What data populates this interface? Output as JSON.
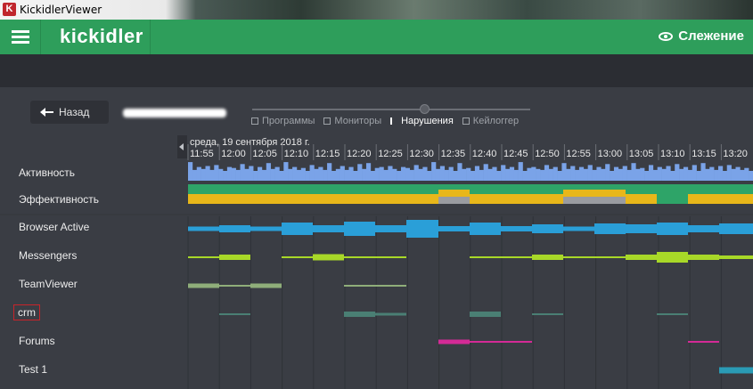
{
  "window": {
    "title": "KickidlerViewer",
    "icon_letter": "K"
  },
  "header": {
    "logo": "kickidler",
    "mode_label": "Слежение"
  },
  "back_button": {
    "label": "Назад"
  },
  "view_tabs": [
    {
      "label": "Программы",
      "icon": "folder-icon",
      "active": false
    },
    {
      "label": "Мониторы",
      "icon": "monitor-icon",
      "active": false
    },
    {
      "label": "Нарушения",
      "icon": "flag-icon",
      "active": true
    },
    {
      "label": "Кейлоггер",
      "icon": "keyboard-icon",
      "active": false
    }
  ],
  "timeline": {
    "date": "среда, 19 сентября 2018 г.",
    "times": [
      "11:55",
      "12:00",
      "12:05",
      "12:10",
      "12:15",
      "12:20",
      "12:25",
      "12:30",
      "12:35",
      "12:40",
      "12:45",
      "12:50",
      "12:55",
      "13:00",
      "13:05",
      "13:10",
      "13:15",
      "13:20"
    ],
    "rows": [
      {
        "label": "Активность",
        "flagged": false
      },
      {
        "label": "Эффективность",
        "flagged": false
      },
      {
        "label": "Browser Active",
        "flagged": false
      },
      {
        "label": "Messengers",
        "flagged": false
      },
      {
        "label": "TeamViewer",
        "flagged": false
      },
      {
        "label": "crm",
        "flagged": true
      },
      {
        "label": "Forums",
        "flagged": false
      },
      {
        "label": "Test 1",
        "flagged": false
      }
    ]
  },
  "colors": {
    "accent_green": "#2e9e5b",
    "activity": "#7aa3e8",
    "efficiency_green": "#2ea468",
    "efficiency_yellow": "#e8b71a",
    "efficiency_gray": "#9a9ca1",
    "browser": "#2a9fd8",
    "messengers": "#a8d828",
    "teamviewer": "#8fae7a",
    "crm": "#4a7f74",
    "forums": "#d42a96",
    "test1": "#2a9bb5"
  }
}
